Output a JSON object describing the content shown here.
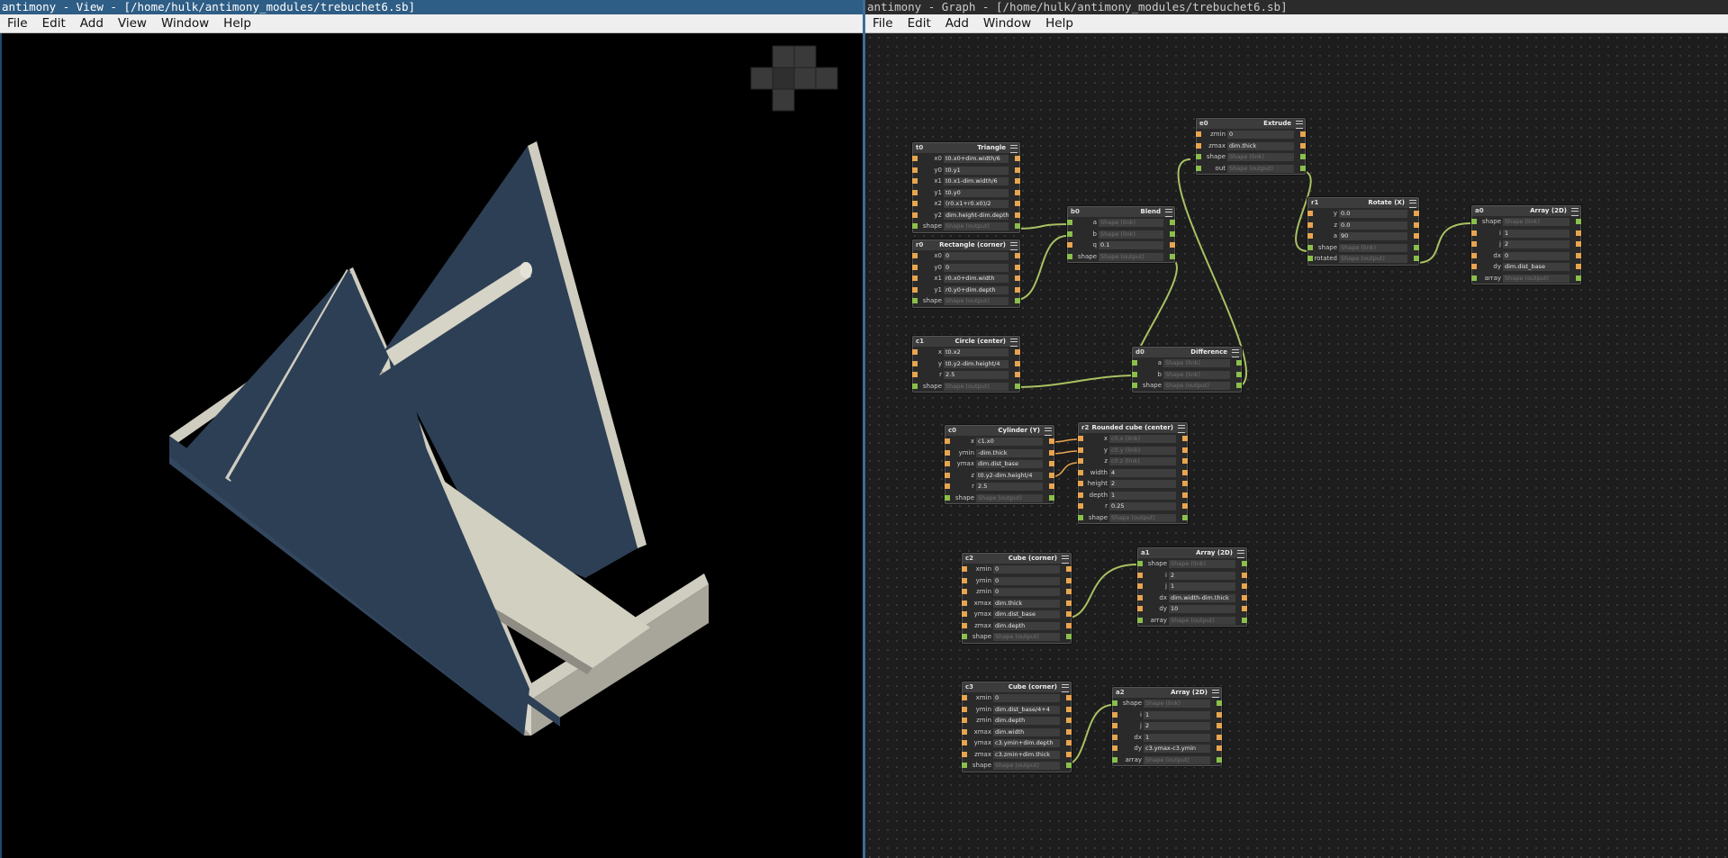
{
  "view_window": {
    "title": "antimony - View - [/home/hulk/antimony_modules/trebuchet6.sb]",
    "menu": [
      "File",
      "Edit",
      "Add",
      "View",
      "Window",
      "Help"
    ]
  },
  "graph_window": {
    "title": "antimony - Graph - [/home/hulk/antimony_modules/trebuchet6.sb]",
    "menu": [
      "File",
      "Edit",
      "Add",
      "Window",
      "Help"
    ]
  },
  "colors": {
    "panel": "#2d3f55",
    "beam": "#d2d0c0",
    "node_bg": "#2a2a2a",
    "port_number": "#e8a550",
    "port_shape": "#8bbf4c",
    "wire": "#a9c163"
  },
  "nodes": [
    {
      "id": "t0",
      "title": "Triangle",
      "rows": [
        [
          "x0",
          "t0.x0+dim.width/6",
          "n"
        ],
        [
          "y0",
          "t0.y1",
          "n"
        ],
        [
          "x1",
          "t0.x1-dim.width/6",
          "n"
        ],
        [
          "y1",
          "t0.y0",
          "n"
        ],
        [
          "x2",
          "(r0.x1+r0.x0)/2",
          "n"
        ],
        [
          "y2",
          "dim.height-dim.depth",
          "n"
        ],
        [
          "shape",
          "Shape (output)",
          "s"
        ]
      ]
    },
    {
      "id": "r0",
      "title": "Rectangle (corner)",
      "rows": [
        [
          "x0",
          "0",
          "n"
        ],
        [
          "y0",
          "0",
          "n"
        ],
        [
          "x1",
          "r0.x0+dim.width",
          "n"
        ],
        [
          "y1",
          "r0.y0+dim.depth",
          "n"
        ],
        [
          "shape",
          "Shape (output)",
          "s"
        ]
      ]
    },
    {
      "id": "c1",
      "title": "Circle (center)",
      "rows": [
        [
          "x",
          "t0.x2",
          "n"
        ],
        [
          "y",
          "t0.y2-dim.height/4",
          "n"
        ],
        [
          "r",
          "2.5",
          "n"
        ],
        [
          "shape",
          "Shape (output)",
          "s"
        ]
      ]
    },
    {
      "id": "b0",
      "title": "Blend",
      "rows": [
        [
          "a",
          "Shape (link)",
          "s"
        ],
        [
          "b",
          "Shape (link)",
          "s"
        ],
        [
          "q",
          "0.1",
          "n"
        ],
        [
          "shape",
          "Shape (output)",
          "s"
        ]
      ]
    },
    {
      "id": "d0",
      "title": "Difference",
      "rows": [
        [
          "a",
          "Shape (link)",
          "s"
        ],
        [
          "b",
          "Shape (link)",
          "s"
        ],
        [
          "shape",
          "Shape (output)",
          "s"
        ]
      ]
    },
    {
      "id": "e0",
      "title": "Extrude",
      "rows": [
        [
          "zmin",
          "0",
          "n"
        ],
        [
          "zmax",
          "dim.thick",
          "n"
        ],
        [
          "shape",
          "Shape (link)",
          "s"
        ],
        [
          "out",
          "Shape (output)",
          "s"
        ]
      ]
    },
    {
      "id": "r1",
      "title": "Rotate (X)",
      "rows": [
        [
          "y",
          "0.0",
          "n"
        ],
        [
          "z",
          "0.0",
          "n"
        ],
        [
          "a",
          "90",
          "n"
        ],
        [
          "shape",
          "Shape (link)",
          "s"
        ],
        [
          "rotated",
          "Shape (output)",
          "s"
        ]
      ]
    },
    {
      "id": "a0",
      "title": "Array (2D)",
      "rows": [
        [
          "shape",
          "Shape (link)",
          "s"
        ],
        [
          "i",
          "1",
          "n"
        ],
        [
          "j",
          "2",
          "n"
        ],
        [
          "dx",
          "0",
          "n"
        ],
        [
          "dy",
          "dim.dist_base",
          "n"
        ],
        [
          "array",
          "Shape (output)",
          "s"
        ]
      ]
    },
    {
      "id": "c0",
      "title": "Cylinder (Y)",
      "rows": [
        [
          "x",
          "c1.x0",
          "n"
        ],
        [
          "ymin",
          "-dim.thick",
          "n"
        ],
        [
          "ymax",
          "dim.dist_base",
          "n"
        ],
        [
          "z",
          "t0.y2-dim.height/4",
          "n"
        ],
        [
          "r",
          "2.5",
          "n"
        ],
        [
          "shape",
          "Shape (output)",
          "s"
        ]
      ]
    },
    {
      "id": "r2",
      "title": "Rounded cube (center)",
      "rows": [
        [
          "x",
          "c0.x (link)",
          "n"
        ],
        [
          "y",
          "c0.y (link)",
          "n"
        ],
        [
          "z",
          "c0.z (link)",
          "n"
        ],
        [
          "width",
          "4",
          "n"
        ],
        [
          "height",
          "2",
          "n"
        ],
        [
          "depth",
          "1",
          "n"
        ],
        [
          "r",
          "0.25",
          "n"
        ],
        [
          "shape",
          "Shape (output)",
          "s"
        ]
      ]
    },
    {
      "id": "c2",
      "title": "Cube (corner)",
      "rows": [
        [
          "xmin",
          "0",
          "n"
        ],
        [
          "ymin",
          "0",
          "n"
        ],
        [
          "zmin",
          "0",
          "n"
        ],
        [
          "xmax",
          "dim.thick",
          "n"
        ],
        [
          "ymax",
          "dim.dist_base",
          "n"
        ],
        [
          "zmax",
          "dim.depth",
          "n"
        ],
        [
          "shape",
          "Shape (output)",
          "s"
        ]
      ]
    },
    {
      "id": "a1",
      "title": "Array (2D)",
      "rows": [
        [
          "shape",
          "Shape (link)",
          "s"
        ],
        [
          "i",
          "2",
          "n"
        ],
        [
          "j",
          "1",
          "n"
        ],
        [
          "dx",
          "dim.width-dim.thick",
          "n"
        ],
        [
          "dy",
          "10",
          "n"
        ],
        [
          "array",
          "Shape (output)",
          "s"
        ]
      ]
    },
    {
      "id": "c3",
      "title": "Cube (corner)",
      "rows": [
        [
          "xmin",
          "0",
          "n"
        ],
        [
          "ymin",
          "dim.dist_base/4+4",
          "n"
        ],
        [
          "zmin",
          "dim.depth",
          "n"
        ],
        [
          "xmax",
          "dim.width",
          "n"
        ],
        [
          "ymax",
          "c3.ymin+dim.depth",
          "n"
        ],
        [
          "zmax",
          "c3.zmin+dim.thick",
          "n"
        ],
        [
          "shape",
          "Shape (output)",
          "s"
        ]
      ]
    },
    {
      "id": "a2",
      "title": "Array (2D)",
      "rows": [
        [
          "shape",
          "Shape (link)",
          "s"
        ],
        [
          "i",
          "1",
          "n"
        ],
        [
          "j",
          "2",
          "n"
        ],
        [
          "dx",
          "1",
          "n"
        ],
        [
          "dy",
          "c3.ymax-c3.ymin",
          "n"
        ],
        [
          "array",
          "Shape (output)",
          "s"
        ]
      ]
    }
  ]
}
